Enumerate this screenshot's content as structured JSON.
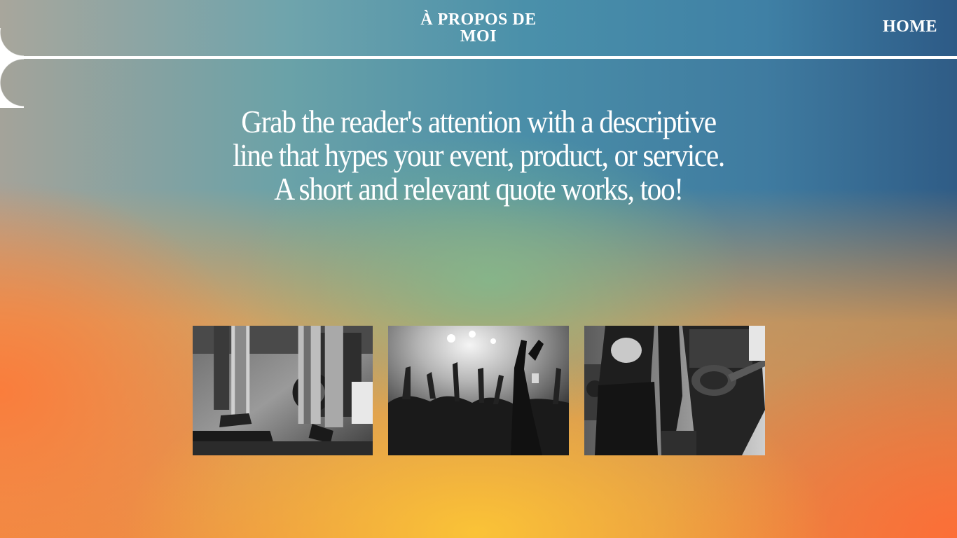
{
  "header": {
    "center_link": "À PROPOS DE MOI",
    "home_link": "HOME"
  },
  "hero": {
    "headline": "Grab the reader's attention with a descriptive line that hypes your event, product, or service. A short and relevant quote works, too!"
  },
  "gallery": {
    "photos": [
      {
        "subject": "concert-stage-feet-photo"
      },
      {
        "subject": "concert-crowd-hands-photo"
      },
      {
        "subject": "concert-band-guitarist-photo"
      }
    ]
  },
  "colors": {
    "header_gradient_start": "#a8a69c",
    "header_gradient_end": "#2d5a86",
    "accent_orange": "#f98a3c",
    "accent_yellow": "#f7bc3a",
    "text": "#ffffff"
  }
}
